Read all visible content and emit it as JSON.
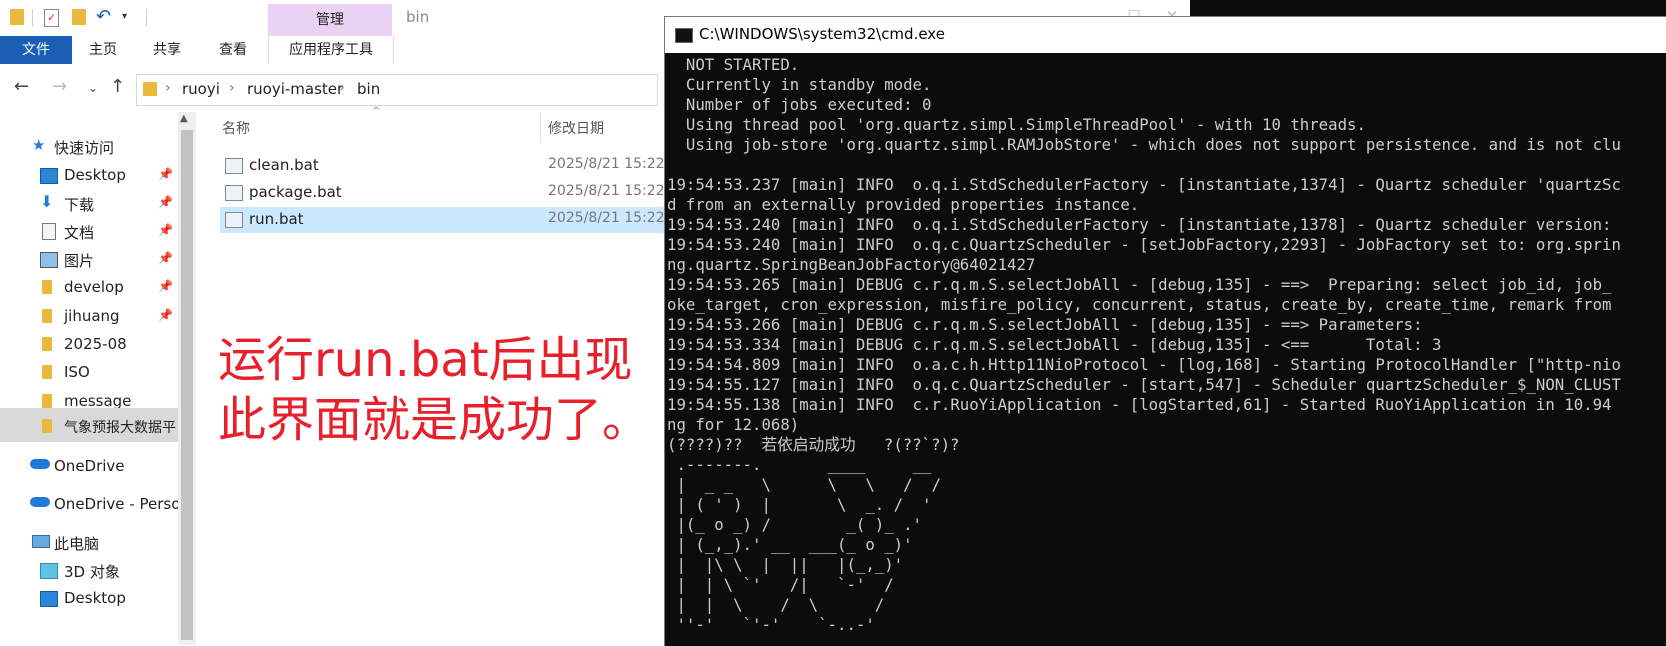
{
  "explorer": {
    "context_group": "管理",
    "window_title": "bin",
    "ribbon_tabs": [
      "文件",
      "主页",
      "共享",
      "查看",
      "应用程序工具"
    ],
    "breadcrumb": [
      "ruoyi",
      "ruoyi-master",
      "bin"
    ],
    "nav_items": [
      {
        "label": "快速访问",
        "icon": "star-icon",
        "pinned": false
      },
      {
        "label": "Desktop",
        "icon": "desktop-icon",
        "pinned": true
      },
      {
        "label": "下载",
        "icon": "download-icon",
        "pinned": true
      },
      {
        "label": "文档",
        "icon": "document-icon",
        "pinned": true
      },
      {
        "label": "图片",
        "icon": "picture-icon",
        "pinned": true
      },
      {
        "label": "develop",
        "icon": "folder-icon",
        "pinned": true
      },
      {
        "label": "jihuang",
        "icon": "folder-icon",
        "pinned": true
      },
      {
        "label": "2025-08",
        "icon": "folder-icon",
        "pinned": false
      },
      {
        "label": "ISO",
        "icon": "folder-icon",
        "pinned": false
      },
      {
        "label": "message",
        "icon": "folder-icon",
        "pinned": false
      },
      {
        "label": "气象预报大数据平",
        "icon": "folder-icon",
        "pinned": false
      },
      {
        "label": "OneDrive",
        "icon": "cloud-icon",
        "pinned": false
      },
      {
        "label": "OneDrive - Perso",
        "icon": "cloud-icon",
        "pinned": false
      },
      {
        "label": "此电脑",
        "icon": "computer-icon",
        "pinned": false
      },
      {
        "label": "3D 对象",
        "icon": "cube-icon",
        "pinned": false
      },
      {
        "label": "Desktop",
        "icon": "desktop-icon",
        "pinned": false
      }
    ],
    "columns": {
      "name": "名称",
      "modified": "修改日期"
    },
    "files": [
      {
        "name": "clean.bat",
        "date": "2025/8/21 15:22"
      },
      {
        "name": "package.bat",
        "date": "2025/8/21 15:22"
      },
      {
        "name": "run.bat",
        "date": "2025/8/21 15:22",
        "selected": true
      }
    ],
    "annotation": [
      "运行run.bat后出现",
      "此界面就是成功了。"
    ]
  },
  "cmd": {
    "title": "C:\\WINDOWS\\system32\\cmd.exe",
    "lines": [
      "  NOT STARTED.",
      "  Currently in standby mode.",
      "  Number of jobs executed: 0",
      "  Using thread pool 'org.quartz.simpl.SimpleThreadPool' - with 10 threads.",
      "  Using job-store 'org.quartz.simpl.RAMJobStore' - which does not support persistence. and is not clu",
      "",
      "19:54:53.237 [main] INFO  o.q.i.StdSchedulerFactory - [instantiate,1374] - Quartz scheduler 'quartzSc",
      "d from an externally provided properties instance.",
      "19:54:53.240 [main] INFO  o.q.i.StdSchedulerFactory - [instantiate,1378] - Quartz scheduler version:",
      "19:54:53.240 [main] INFO  o.q.c.QuartzScheduler - [setJobFactory,2293] - JobFactory set to: org.sprin",
      "ng.quartz.SpringBeanJobFactory@64021427",
      "19:54:53.265 [main] DEBUG c.r.q.m.S.selectJobAll - [debug,135] - ==>  Preparing: select job_id, job_",
      "oke_target, cron_expression, misfire_policy, concurrent, status, create_by, create_time, remark from",
      "19:54:53.266 [main] DEBUG c.r.q.m.S.selectJobAll - [debug,135] - ==> Parameters:",
      "19:54:53.334 [main] DEBUG c.r.q.m.S.selectJobAll - [debug,135] - <==      Total: 3",
      "19:54:54.809 [main] INFO  o.a.c.h.Http11NioProtocol - [log,168] - Starting ProtocolHandler [\"http-nio",
      "19:54:55.127 [main] INFO  o.q.c.QuartzScheduler - [start,547] - Scheduler quartzScheduler_$_NON_CLUST",
      "19:54:55.138 [main] INFO  c.r.RuoYiApplication - [logStarted,61] - Started RuoYiApplication in 10.94",
      "ng for 12.068)",
      "(????)??  若依启动成功   ?(??`?)?",
      " .-------.       ____     __",
      " |  _ _   \\      \\   \\   /  /",
      " | ( ' )  |       \\  _. /  '",
      " |(_ o _) /        _( )_ .'",
      " | (_,_).' __  ___(_ o _)'",
      " |  |\\ \\  |  ||   |(_,_)'",
      " |  | \\ `'   /|   `-'  /",
      " |  |  \\    /  \\      /",
      " ''-'   `'-'    `-..-'"
    ]
  }
}
